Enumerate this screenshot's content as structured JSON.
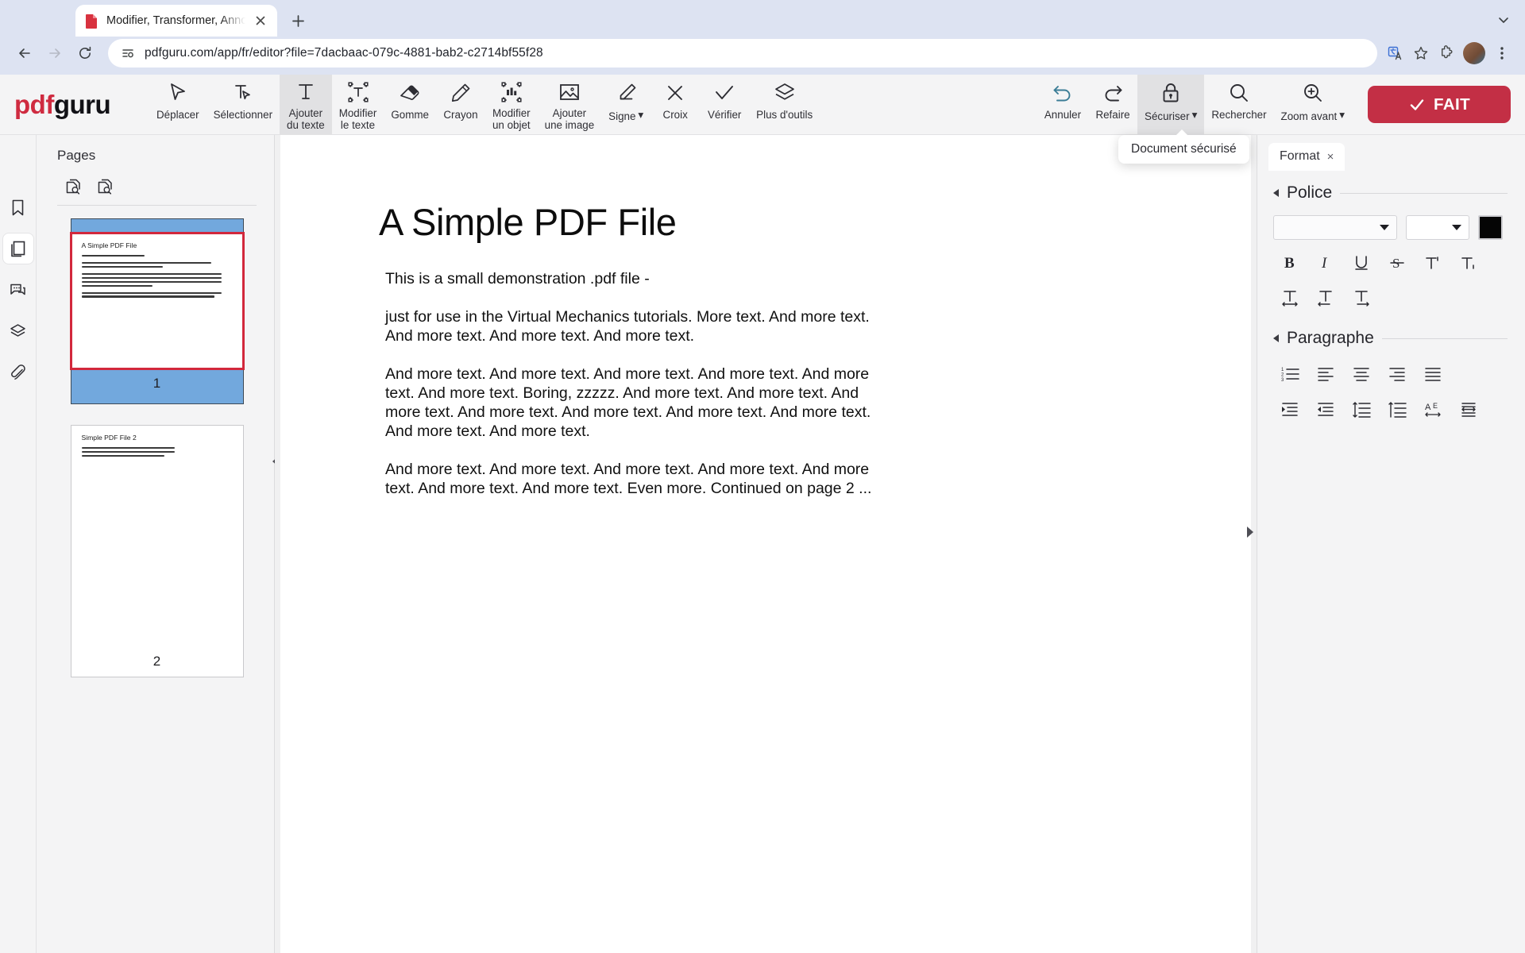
{
  "browser": {
    "tab": {
      "title": "Modifier, Transformer, Annote",
      "favicon": "pdf-file-icon",
      "close": "×"
    },
    "new_tab_label": "+",
    "url": "pdfguru.com/app/fr/editor?file=7dacbaac-079c-4881-bab2-c2714bf55f28",
    "icons": {
      "back": "back-arrow-icon",
      "forward": "forward-arrow-icon",
      "reload": "reload-icon",
      "site_settings": "page-info-icon",
      "translate": "translate-icon",
      "bookmark": "star-icon",
      "extensions": "puzzle-icon",
      "menu": "kebab-menu-icon",
      "collapse": "chevron-down-icon"
    }
  },
  "app": {
    "brand": {
      "pdf": "pdf",
      "guru": "guru"
    },
    "tools": [
      {
        "label": "Déplacer",
        "icon": "cursor-arrow-icon",
        "active": false,
        "caret": false
      },
      {
        "label": "Sélectionner",
        "icon": "text-select-icon",
        "active": false,
        "caret": false
      },
      {
        "label": "Ajouter\ndu texte",
        "icon": "add-text-icon",
        "active": true,
        "caret": false
      },
      {
        "label": "Modifier\nle texte",
        "icon": "edit-text-box-icon",
        "active": false,
        "caret": false
      },
      {
        "label": "Gomme",
        "icon": "eraser-icon",
        "active": false,
        "caret": false
      },
      {
        "label": "Crayon",
        "icon": "pencil-icon",
        "active": false,
        "caret": false
      },
      {
        "label": "Modifier\nun objet",
        "icon": "edit-object-icon",
        "active": false,
        "caret": true
      },
      {
        "label": "Ajouter\nune image",
        "icon": "image-icon",
        "active": false,
        "caret": false
      },
      {
        "label": "Signe",
        "icon": "signature-pen-icon",
        "active": false,
        "caret": true
      },
      {
        "label": "Croix",
        "icon": "cross-x-icon",
        "active": false,
        "caret": false
      },
      {
        "label": "Vérifier",
        "icon": "check-mark-icon",
        "active": false,
        "caret": false
      },
      {
        "label": "Plus d'outils",
        "icon": "layers-stack-icon",
        "active": false,
        "caret": false
      }
    ],
    "tools_right": [
      {
        "label": "Annuler",
        "icon": "undo-icon",
        "active": false,
        "caret": false,
        "accent": "#3b7d96"
      },
      {
        "label": "Refaire",
        "icon": "redo-icon",
        "active": false,
        "caret": false
      },
      {
        "label": "Sécuriser",
        "icon": "lock-icon",
        "active": true,
        "caret": true
      },
      {
        "label": "Rechercher",
        "icon": "search-icon",
        "active": false,
        "caret": false
      },
      {
        "label": "Zoom avant",
        "icon": "zoom-in-icon",
        "active": false,
        "caret": true
      }
    ],
    "done_button": {
      "label": "FAIT",
      "icon": "check-icon",
      "color": "#c32f45"
    },
    "tooltip": {
      "text": "Document sécurisé"
    }
  },
  "rail": {
    "items": [
      {
        "icon": "bookmark-icon",
        "active": false
      },
      {
        "icon": "pages-icon",
        "active": true
      },
      {
        "icon": "comment-icon",
        "active": false
      },
      {
        "icon": "layers-icon",
        "active": false
      },
      {
        "icon": "attachment-icon",
        "active": false
      }
    ]
  },
  "pages_panel": {
    "title": "Pages",
    "tools": [
      {
        "icon": "insert-page-icon"
      },
      {
        "icon": "extract-page-icon"
      }
    ],
    "thumbnails": [
      {
        "number": "1",
        "selected": true,
        "heading": "A Simple PDF File",
        "lines": [
          1,
          2,
          4,
          2
        ]
      },
      {
        "number": "2",
        "selected": false,
        "heading": "Simple PDF File 2",
        "lines": [
          3
        ]
      }
    ]
  },
  "document": {
    "title": "A Simple PDF File",
    "paragraphs": [
      "This is a small demonstration .pdf file -",
      "just for use in the Virtual Mechanics tutorials. More text. And more text. And more text. And more text. And more text.",
      "And more text. And more text. And more text. And more text. And more text. And more text. Boring, zzzzz. And more text. And more text. And more text. And more text. And more text. And more text. And more text. And more text. And more text.",
      "And more text. And more text. And more text. And more text. And more text. And more text. And more text. Even more. Continued on page 2 ..."
    ]
  },
  "format_panel": {
    "tab": {
      "label": "Format",
      "close": "×"
    },
    "sections": [
      {
        "title": "Police"
      },
      {
        "title": "Paragraphe"
      }
    ],
    "font_select": {
      "value": "",
      "placeholder": ""
    },
    "size_select": {
      "value": "",
      "placeholder": ""
    },
    "color": "#050505",
    "font_icons": [
      {
        "icon": "bold-icon",
        "label": "B"
      },
      {
        "icon": "italic-icon",
        "label": "I"
      },
      {
        "icon": "underline-icon",
        "label": "U"
      },
      {
        "icon": "strikethrough-icon",
        "label": "S"
      },
      {
        "icon": "superscript-icon",
        "label": "T'"
      },
      {
        "icon": "subscript-icon",
        "label": "T,"
      }
    ],
    "font_icons_row2": [
      {
        "icon": "char-spacing-icon"
      },
      {
        "icon": "text-shrink-icon"
      },
      {
        "icon": "text-expand-icon"
      }
    ],
    "paragraph_icons": [
      {
        "icon": "numbered-list-icon"
      },
      {
        "icon": "align-left-icon"
      },
      {
        "icon": "align-center-icon"
      },
      {
        "icon": "align-right-icon"
      },
      {
        "icon": "align-justify-icon"
      }
    ],
    "paragraph_icons_row2": [
      {
        "icon": "indent-increase-icon"
      },
      {
        "icon": "indent-decrease-icon"
      },
      {
        "icon": "line-spacing-icon"
      },
      {
        "icon": "paragraph-spacing-icon"
      },
      {
        "icon": "text-direction-icon"
      },
      {
        "icon": "distribute-lines-icon"
      }
    ]
  }
}
